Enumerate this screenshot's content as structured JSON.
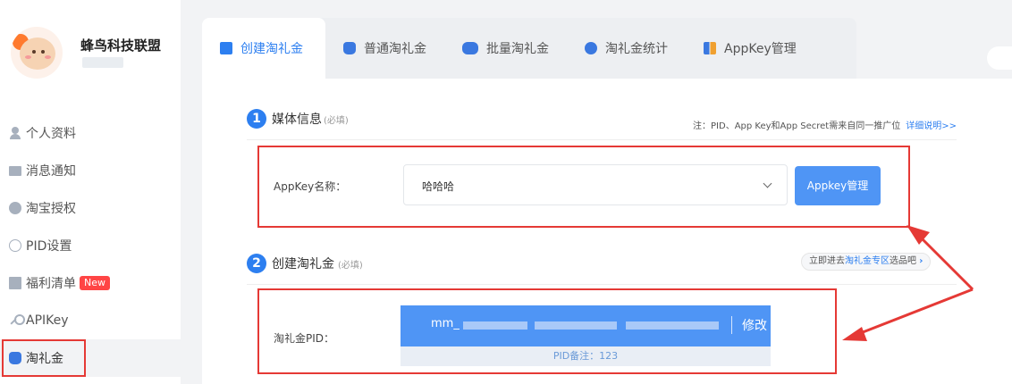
{
  "sidebar": {
    "username": "蜂鸟科技联盟",
    "items": [
      {
        "label": "个人资料",
        "icon": "person-icon"
      },
      {
        "label": "消息通知",
        "icon": "mail-icon"
      },
      {
        "label": "淘宝授权",
        "icon": "taobao-icon"
      },
      {
        "label": "PID设置",
        "icon": "gear-icon"
      },
      {
        "label": "福利清单",
        "icon": "list-icon",
        "badge": "New"
      },
      {
        "label": "APIKey",
        "icon": "key-icon"
      },
      {
        "label": "淘礼金",
        "icon": "money-bag-icon",
        "active": true
      }
    ]
  },
  "tabs": [
    {
      "label": "创建淘礼金",
      "icon": "document-plus-icon",
      "active": true
    },
    {
      "label": "普通淘礼金",
      "icon": "money-bag-icon"
    },
    {
      "label": "批量淘礼金",
      "icon": "money-bags-icon"
    },
    {
      "label": "淘礼金统计",
      "icon": "chart-icon"
    },
    {
      "label": "AppKey管理",
      "icon": "grid-icon"
    }
  ],
  "section1": {
    "num": "1",
    "title": "媒体信息",
    "required": "(必填)",
    "note": "注：PID、App Key和App Secret需来自同一推广位",
    "detail_link": "详细说明>>",
    "field_label": "AppKey名称：",
    "select_value": "哈哈哈",
    "manage_button": "Appkey管理"
  },
  "section2": {
    "num": "2",
    "title": "创建淘礼金",
    "required": "(必填)",
    "goto_prefix": "立即进去",
    "goto_highlight": "淘礼金专区",
    "goto_suffix": "选品吧",
    "field_label": "淘礼金PID：",
    "pid_value": "mm_",
    "edit_label": "修改",
    "pid_note": "PID备注：123"
  },
  "colors": {
    "accent": "#2d7ff0",
    "button": "#4f95f5",
    "highlight_red": "#e53935",
    "badge_red": "#ff4545"
  }
}
